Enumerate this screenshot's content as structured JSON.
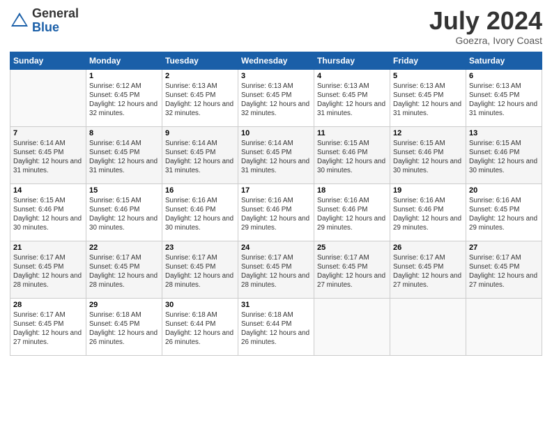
{
  "header": {
    "logo_general": "General",
    "logo_blue": "Blue",
    "month_title": "July 2024",
    "location": "Goezra, Ivory Coast"
  },
  "days_of_week": [
    "Sunday",
    "Monday",
    "Tuesday",
    "Wednesday",
    "Thursday",
    "Friday",
    "Saturday"
  ],
  "weeks": [
    [
      {
        "day": "",
        "info": ""
      },
      {
        "day": "1",
        "info": "Sunrise: 6:12 AM\nSunset: 6:45 PM\nDaylight: 12 hours\nand 32 minutes."
      },
      {
        "day": "2",
        "info": "Sunrise: 6:13 AM\nSunset: 6:45 PM\nDaylight: 12 hours\nand 32 minutes."
      },
      {
        "day": "3",
        "info": "Sunrise: 6:13 AM\nSunset: 6:45 PM\nDaylight: 12 hours\nand 32 minutes."
      },
      {
        "day": "4",
        "info": "Sunrise: 6:13 AM\nSunset: 6:45 PM\nDaylight: 12 hours\nand 31 minutes."
      },
      {
        "day": "5",
        "info": "Sunrise: 6:13 AM\nSunset: 6:45 PM\nDaylight: 12 hours\nand 31 minutes."
      },
      {
        "day": "6",
        "info": "Sunrise: 6:13 AM\nSunset: 6:45 PM\nDaylight: 12 hours\nand 31 minutes."
      }
    ],
    [
      {
        "day": "7",
        "info": ""
      },
      {
        "day": "8",
        "info": "Sunrise: 6:14 AM\nSunset: 6:45 PM\nDaylight: 12 hours\nand 31 minutes."
      },
      {
        "day": "9",
        "info": "Sunrise: 6:14 AM\nSunset: 6:45 PM\nDaylight: 12 hours\nand 31 minutes."
      },
      {
        "day": "10",
        "info": "Sunrise: 6:14 AM\nSunset: 6:45 PM\nDaylight: 12 hours\nand 31 minutes."
      },
      {
        "day": "11",
        "info": "Sunrise: 6:15 AM\nSunset: 6:46 PM\nDaylight: 12 hours\nand 30 minutes."
      },
      {
        "day": "12",
        "info": "Sunrise: 6:15 AM\nSunset: 6:46 PM\nDaylight: 12 hours\nand 30 minutes."
      },
      {
        "day": "13",
        "info": "Sunrise: 6:15 AM\nSunset: 6:46 PM\nDaylight: 12 hours\nand 30 minutes."
      }
    ],
    [
      {
        "day": "14",
        "info": ""
      },
      {
        "day": "15",
        "info": "Sunrise: 6:15 AM\nSunset: 6:46 PM\nDaylight: 12 hours\nand 30 minutes."
      },
      {
        "day": "16",
        "info": "Sunrise: 6:16 AM\nSunset: 6:46 PM\nDaylight: 12 hours\nand 30 minutes."
      },
      {
        "day": "17",
        "info": "Sunrise: 6:16 AM\nSunset: 6:46 PM\nDaylight: 12 hours\nand 29 minutes."
      },
      {
        "day": "18",
        "info": "Sunrise: 6:16 AM\nSunset: 6:46 PM\nDaylight: 12 hours\nand 29 minutes."
      },
      {
        "day": "19",
        "info": "Sunrise: 6:16 AM\nSunset: 6:46 PM\nDaylight: 12 hours\nand 29 minutes."
      },
      {
        "day": "20",
        "info": "Sunrise: 6:16 AM\nSunset: 6:45 PM\nDaylight: 12 hours\nand 29 minutes."
      }
    ],
    [
      {
        "day": "21",
        "info": ""
      },
      {
        "day": "22",
        "info": "Sunrise: 6:17 AM\nSunset: 6:45 PM\nDaylight: 12 hours\nand 28 minutes."
      },
      {
        "day": "23",
        "info": "Sunrise: 6:17 AM\nSunset: 6:45 PM\nDaylight: 12 hours\nand 28 minutes."
      },
      {
        "day": "24",
        "info": "Sunrise: 6:17 AM\nSunset: 6:45 PM\nDaylight: 12 hours\nand 28 minutes."
      },
      {
        "day": "25",
        "info": "Sunrise: 6:17 AM\nSunset: 6:45 PM\nDaylight: 12 hours\nand 27 minutes."
      },
      {
        "day": "26",
        "info": "Sunrise: 6:17 AM\nSunset: 6:45 PM\nDaylight: 12 hours\nand 27 minutes."
      },
      {
        "day": "27",
        "info": "Sunrise: 6:17 AM\nSunset: 6:45 PM\nDaylight: 12 hours\nand 27 minutes."
      }
    ],
    [
      {
        "day": "28",
        "info": "Sunrise: 6:17 AM\nSunset: 6:45 PM\nDaylight: 12 hours\nand 27 minutes."
      },
      {
        "day": "29",
        "info": "Sunrise: 6:18 AM\nSunset: 6:45 PM\nDaylight: 12 hours\nand 26 minutes."
      },
      {
        "day": "30",
        "info": "Sunrise: 6:18 AM\nSunset: 6:44 PM\nDaylight: 12 hours\nand 26 minutes."
      },
      {
        "day": "31",
        "info": "Sunrise: 6:18 AM\nSunset: 6:44 PM\nDaylight: 12 hours\nand 26 minutes."
      },
      {
        "day": "",
        "info": ""
      },
      {
        "day": "",
        "info": ""
      },
      {
        "day": "",
        "info": ""
      }
    ]
  ],
  "week7_info": {
    "day7": "Sunrise: 6:14 AM\nSunset: 6:45 PM\nDaylight: 12 hours\nand 31 minutes.",
    "day14": "Sunrise: 6:15 AM\nSunset: 6:46 PM\nDaylight: 12 hours\nand 30 minutes.",
    "day21": "Sunrise: 6:17 AM\nSunset: 6:45 PM\nDaylight: 12 hours\nand 28 minutes."
  }
}
